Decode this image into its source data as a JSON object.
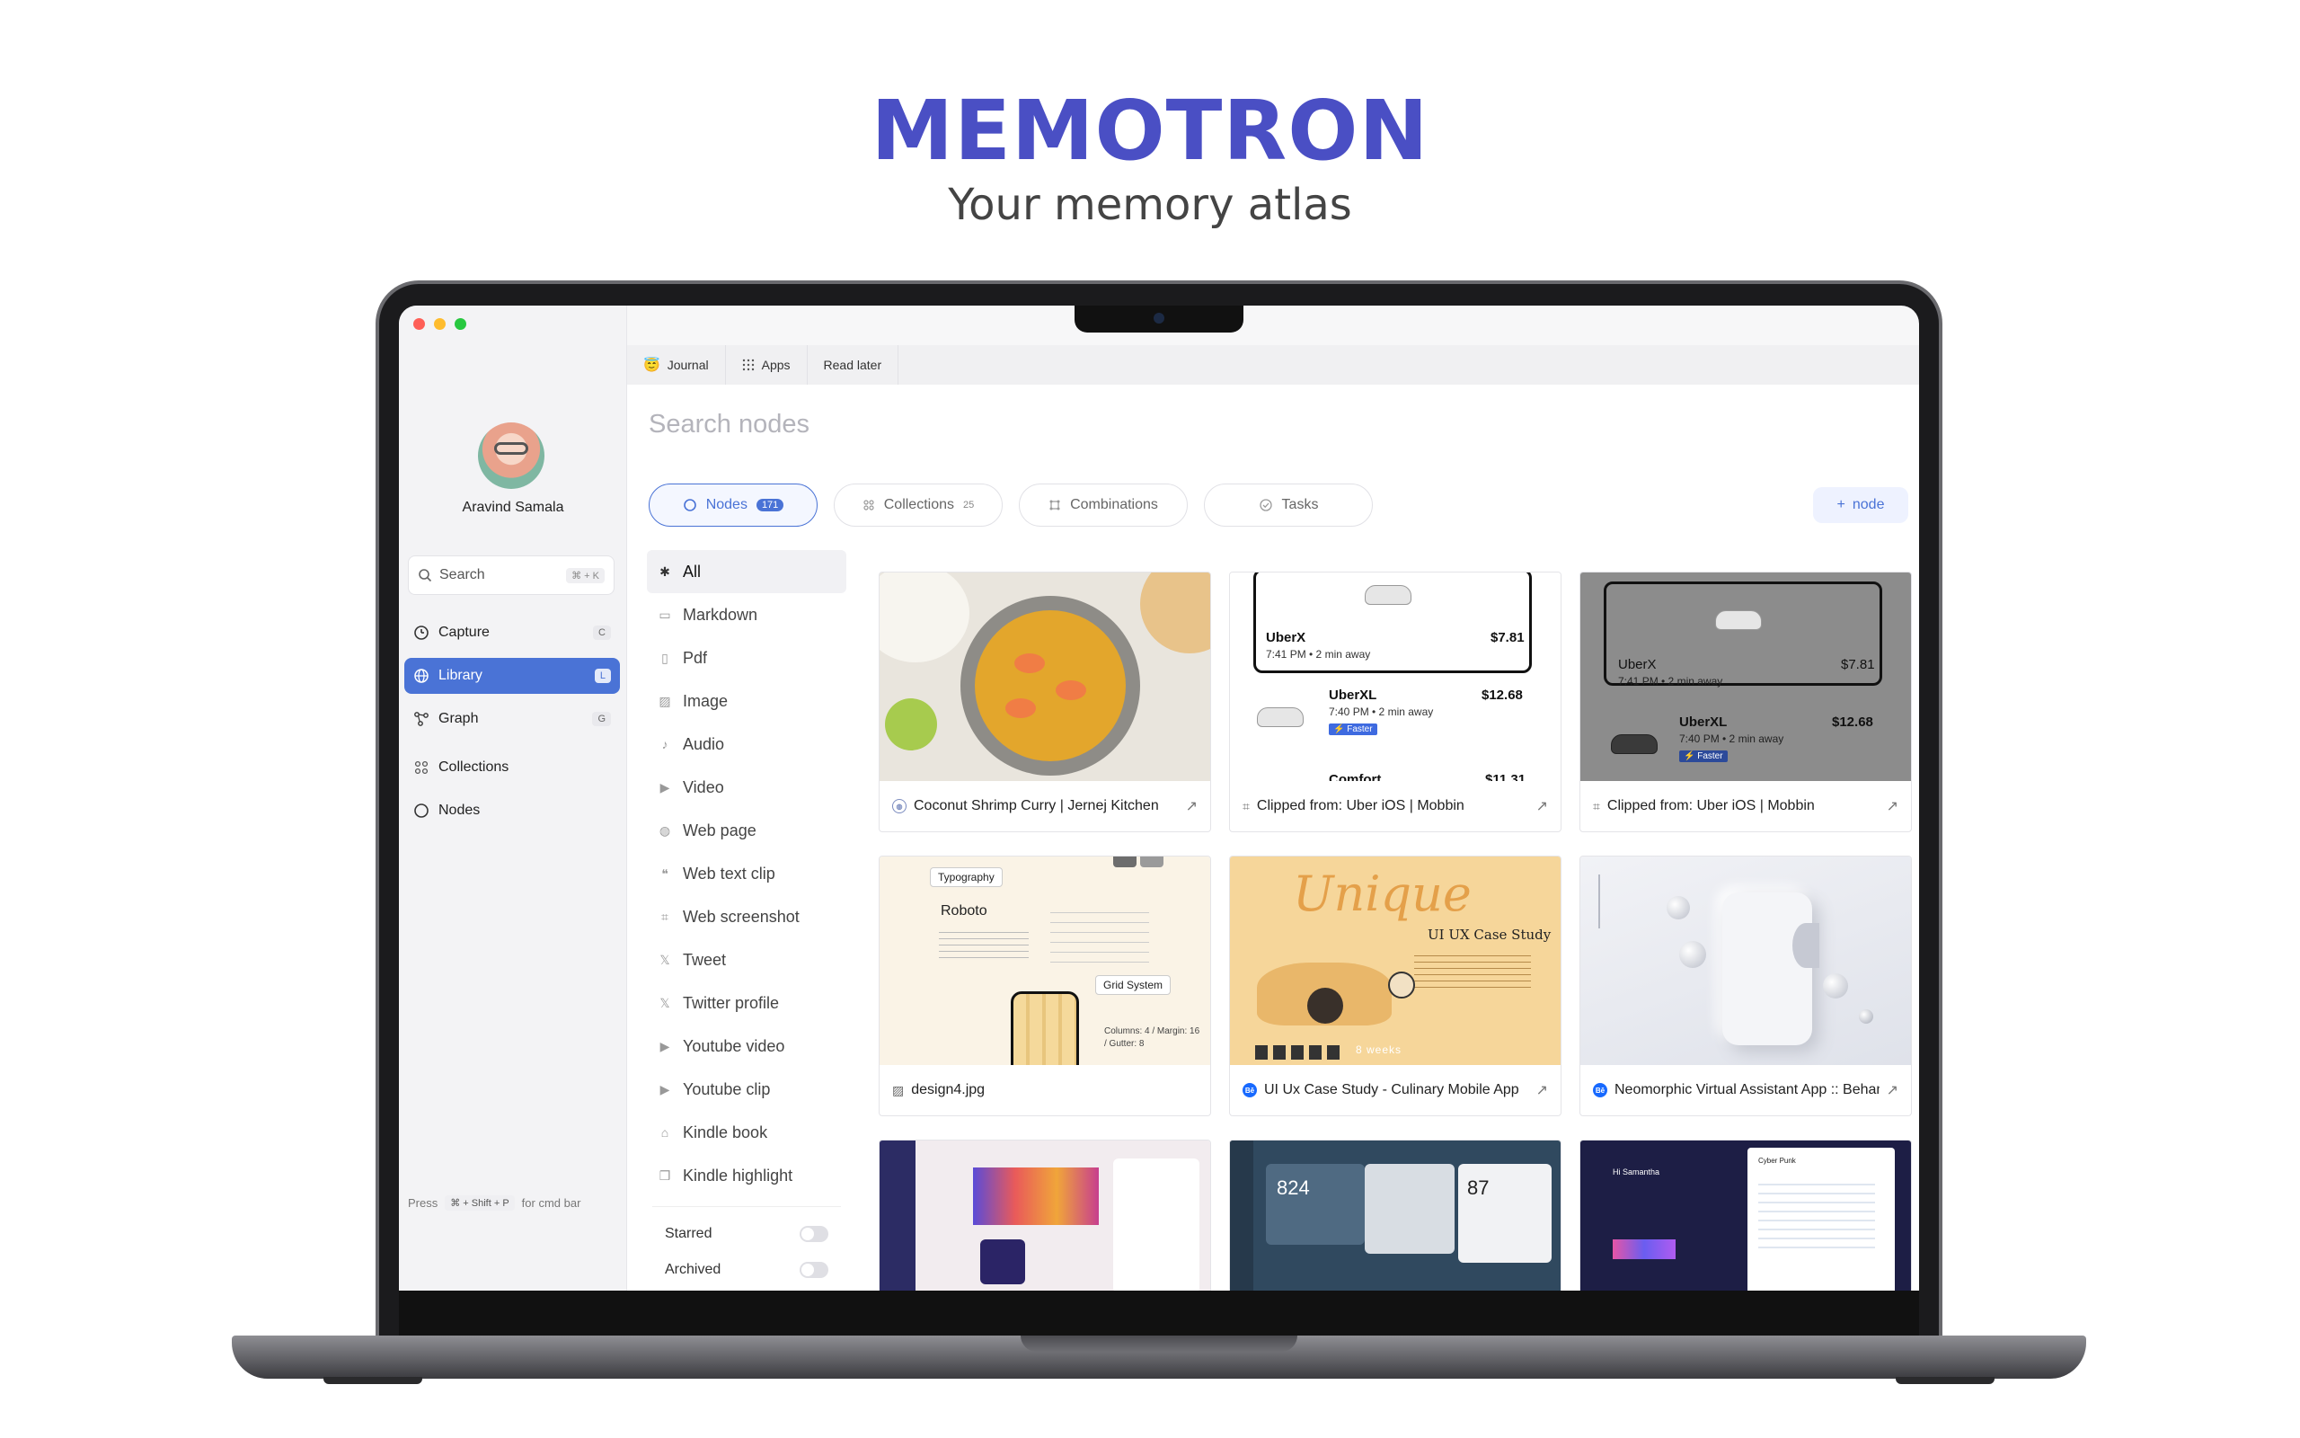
{
  "hero": {
    "title": "MEMOTRON",
    "subtitle": "Your memory atlas"
  },
  "sidebar": {
    "user_name": "Aravind Samala",
    "search": {
      "label": "Search",
      "shortcut": "⌘ + K"
    },
    "nav": [
      {
        "label": "Capture",
        "key": "C",
        "icon": "capture-icon"
      },
      {
        "label": "Library",
        "key": "L",
        "icon": "globe-icon",
        "active": true
      },
      {
        "label": "Graph",
        "key": "G",
        "icon": "graph-icon"
      },
      {
        "label": "Collections",
        "key": "",
        "icon": "collections-icon"
      },
      {
        "label": "Nodes",
        "key": "",
        "icon": "circle-icon"
      }
    ],
    "cmd_hint": {
      "prefix": "Press",
      "keys": "⌘ + Shift + P",
      "suffix": "for cmd bar"
    }
  },
  "top_tabs": [
    {
      "label": "Journal",
      "icon": "emoji-icon"
    },
    {
      "label": "Apps",
      "icon": "grid-icon"
    },
    {
      "label": "Read later",
      "icon": ""
    }
  ],
  "main": {
    "search_placeholder": "Search nodes",
    "pills": [
      {
        "label": "Nodes",
        "count": "171",
        "active": true
      },
      {
        "label": "Collections",
        "count": "25"
      },
      {
        "label": "Combinations",
        "count": ""
      },
      {
        "label": "Tasks",
        "count": ""
      }
    ],
    "add_node_label": "node",
    "filters": [
      "All",
      "Markdown",
      "Pdf",
      "Image",
      "Audio",
      "Video",
      "Web page",
      "Web text clip",
      "Web screenshot",
      "Tweet",
      "Twitter profile",
      "Youtube video",
      "Youtube clip",
      "Kindle book",
      "Kindle highlight"
    ],
    "toggles": [
      "Starred",
      "Archived"
    ],
    "cards": [
      {
        "title": "Coconut Shrimp Curry | Jernej Kitchen",
        "source_icon": "web-icon"
      },
      {
        "title": "Clipped from: Uber iOS | Mobbin",
        "source_icon": "clip-icon"
      },
      {
        "title": "Clipped from: Uber iOS | Mobbin",
        "source_icon": "clip-icon"
      },
      {
        "title": "design4.jpg",
        "source_icon": "image-icon"
      },
      {
        "title": "UI Ux Case Study - Culinary Mobile App",
        "source_icon": "behance-icon"
      },
      {
        "title": "Neomorphic Virtual Assistant App :: Behance",
        "source_icon": "behance-icon"
      }
    ],
    "uber": {
      "uberx": "UberX",
      "uberx_price": "$7.81",
      "uberx_meta": "7:41 PM • 2 min away",
      "uberxl": "UberXL",
      "uberxl_price": "$12.68",
      "uberxl_meta": "7:40 PM • 2 min away",
      "faster": "⚡ Faster",
      "comfort": "Comfort",
      "comfort_price": "$11.31"
    },
    "typo": {
      "badge": "Typography",
      "font": "Roboto",
      "grid": "Grid System",
      "specs": "Columns: 4 / Margin: 16 / Gutter: 8"
    },
    "unique": {
      "logo": "Unique",
      "heading": "UI UX Case Study",
      "weeks": "8 weeks"
    },
    "dash": {
      "n1": "824",
      "n2": "87",
      "hi": "Hi Samantha",
      "cyber": "Cyber Punk"
    }
  },
  "colors": {
    "brand": "#4a4fc4",
    "accent": "#4a73d6"
  }
}
